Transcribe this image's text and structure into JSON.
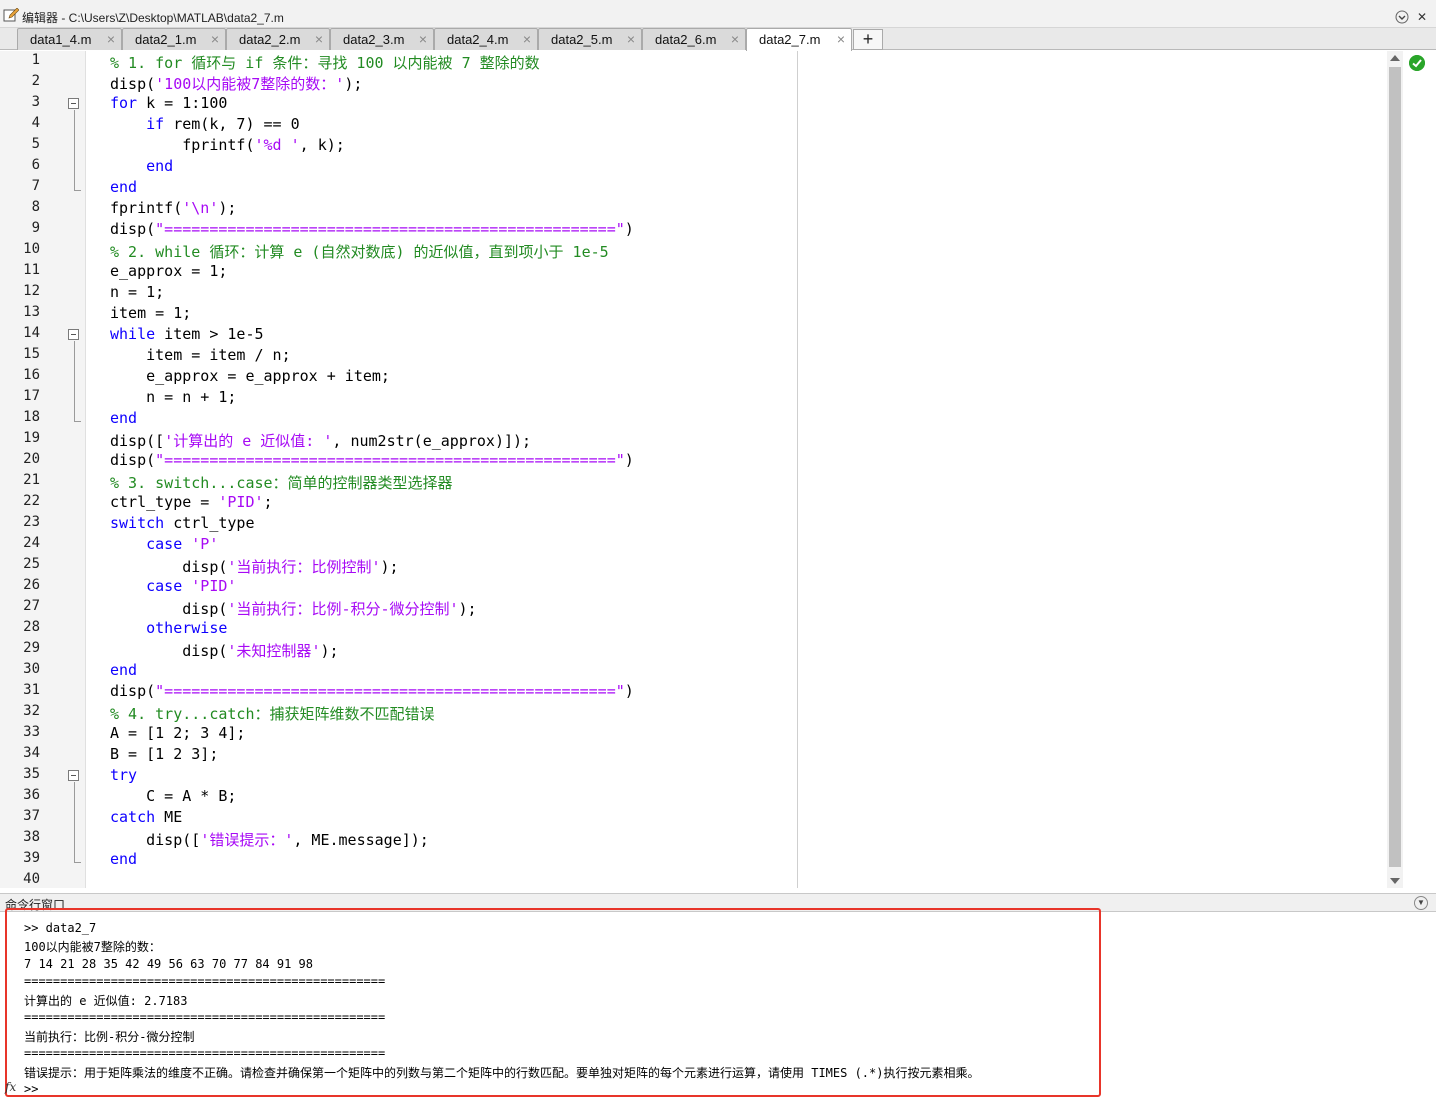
{
  "window": {
    "title": "编辑器 - C:\\Users\\Z\\Desktop\\MATLAB\\data2_7.m",
    "menu_icon": "chevron-down-icon",
    "close_icon": "close-icon"
  },
  "tabs": [
    {
      "label": "data1_4.m",
      "active": false
    },
    {
      "label": "data2_1.m",
      "active": false
    },
    {
      "label": "data2_2.m",
      "active": false
    },
    {
      "label": "data2_3.m",
      "active": false
    },
    {
      "label": "data2_4.m",
      "active": false
    },
    {
      "label": "data2_5.m",
      "active": false
    },
    {
      "label": "data2_6.m",
      "active": false
    },
    {
      "label": "data2_7.m",
      "active": true
    }
  ],
  "tab_close_glyph": "×",
  "tab_add_glyph": "+",
  "editor": {
    "line_numbers": [
      "1",
      "2",
      "3",
      "4",
      "5",
      "6",
      "7",
      "8",
      "9",
      "10",
      "11",
      "12",
      "13",
      "14",
      "15",
      "16",
      "17",
      "18",
      "19",
      "20",
      "21",
      "22",
      "23",
      "24",
      "25",
      "26",
      "27",
      "28",
      "29",
      "30",
      "31",
      "32",
      "33",
      "34",
      "35",
      "36",
      "37",
      "38",
      "39",
      "40"
    ],
    "lines": [
      [
        {
          "t": "% 1. for 循环与 if 条件：寻找 100 以内能被 7 整除的数",
          "c": "cmt"
        }
      ],
      [
        {
          "t": "disp(",
          "c": ""
        },
        {
          "t": "'100以内能被7整除的数：'",
          "c": "str"
        },
        {
          "t": ");",
          "c": ""
        }
      ],
      [
        {
          "t": "for",
          "c": "kw"
        },
        {
          "t": " k = 1:100",
          "c": ""
        }
      ],
      [
        {
          "t": "    ",
          "c": ""
        },
        {
          "t": "if",
          "c": "kw"
        },
        {
          "t": " rem(k, 7) == 0",
          "c": ""
        }
      ],
      [
        {
          "t": "        fprintf(",
          "c": ""
        },
        {
          "t": "'%d '",
          "c": "str"
        },
        {
          "t": ", k);",
          "c": ""
        }
      ],
      [
        {
          "t": "    ",
          "c": ""
        },
        {
          "t": "end",
          "c": "kw"
        }
      ],
      [
        {
          "t": "end",
          "c": "kw"
        }
      ],
      [
        {
          "t": "fprintf(",
          "c": ""
        },
        {
          "t": "'\\n'",
          "c": "str"
        },
        {
          "t": ");",
          "c": ""
        }
      ],
      [
        {
          "t": "disp(",
          "c": ""
        },
        {
          "t": "\"==================================================\"",
          "c": "str"
        },
        {
          "t": ")",
          "c": ""
        }
      ],
      [
        {
          "t": "% 2. while 循环：计算 e (自然对数底) 的近似值，直到项小于 1e-5",
          "c": "cmt"
        }
      ],
      [
        {
          "t": "e_approx = 1;",
          "c": ""
        }
      ],
      [
        {
          "t": "n = 1;",
          "c": ""
        }
      ],
      [
        {
          "t": "item = 1;",
          "c": ""
        }
      ],
      [
        {
          "t": "while",
          "c": "kw"
        },
        {
          "t": " item > 1e-5",
          "c": ""
        }
      ],
      [
        {
          "t": "    item = item / n;",
          "c": ""
        }
      ],
      [
        {
          "t": "    e_approx = e_approx + item;",
          "c": ""
        }
      ],
      [
        {
          "t": "    n = n + 1;",
          "c": ""
        }
      ],
      [
        {
          "t": "end",
          "c": "kw"
        }
      ],
      [
        {
          "t": "disp([",
          "c": ""
        },
        {
          "t": "'计算出的 e 近似值: '",
          "c": "str"
        },
        {
          "t": ", num2str(e_approx)]);",
          "c": ""
        }
      ],
      [
        {
          "t": "disp(",
          "c": ""
        },
        {
          "t": "\"==================================================\"",
          "c": "str"
        },
        {
          "t": ")",
          "c": ""
        }
      ],
      [
        {
          "t": "% 3. switch...case：简单的控制器类型选择器",
          "c": "cmt"
        }
      ],
      [
        {
          "t": "ctrl_type = ",
          "c": ""
        },
        {
          "t": "'PID'",
          "c": "str"
        },
        {
          "t": ";",
          "c": ""
        }
      ],
      [
        {
          "t": "switch",
          "c": "kw"
        },
        {
          "t": " ctrl_type",
          "c": ""
        }
      ],
      [
        {
          "t": "    ",
          "c": ""
        },
        {
          "t": "case",
          "c": "kw"
        },
        {
          "t": " ",
          "c": ""
        },
        {
          "t": "'P'",
          "c": "str"
        }
      ],
      [
        {
          "t": "        disp(",
          "c": ""
        },
        {
          "t": "'当前执行：比例控制'",
          "c": "str"
        },
        {
          "t": ");",
          "c": ""
        }
      ],
      [
        {
          "t": "    ",
          "c": ""
        },
        {
          "t": "case",
          "c": "kw"
        },
        {
          "t": " ",
          "c": ""
        },
        {
          "t": "'PID'",
          "c": "str"
        }
      ],
      [
        {
          "t": "        disp(",
          "c": ""
        },
        {
          "t": "'当前执行：比例-积分-微分控制'",
          "c": "str"
        },
        {
          "t": ");",
          "c": ""
        }
      ],
      [
        {
          "t": "    ",
          "c": ""
        },
        {
          "t": "otherwise",
          "c": "kw"
        }
      ],
      [
        {
          "t": "        disp(",
          "c": ""
        },
        {
          "t": "'未知控制器'",
          "c": "str"
        },
        {
          "t": ");",
          "c": ""
        }
      ],
      [
        {
          "t": "end",
          "c": "kw"
        }
      ],
      [
        {
          "t": "disp(",
          "c": ""
        },
        {
          "t": "\"==================================================\"",
          "c": "str"
        },
        {
          "t": ")",
          "c": ""
        }
      ],
      [
        {
          "t": "% 4. try...catch：捕获矩阵维数不匹配错误",
          "c": "cmt"
        }
      ],
      [
        {
          "t": "A = [1 2; 3 4];",
          "c": ""
        }
      ],
      [
        {
          "t": "B = [1 2 3];",
          "c": ""
        }
      ],
      [
        {
          "t": "try",
          "c": "kw"
        }
      ],
      [
        {
          "t": "    C = A * B;",
          "c": ""
        }
      ],
      [
        {
          "t": "catch",
          "c": "kw"
        },
        {
          "t": " ME",
          "c": ""
        }
      ],
      [
        {
          "t": "    disp([",
          "c": ""
        },
        {
          "t": "'错误提示：'",
          "c": "str"
        },
        {
          "t": ", ME.message]);",
          "c": ""
        }
      ],
      [
        {
          "t": "end",
          "c": "kw"
        }
      ],
      []
    ],
    "status_icon": "check-icon"
  },
  "command_window": {
    "title": "命令行窗口",
    "menu_icon": "chevron-down-icon",
    "output": [
      ">> data2_7",
      "100以内能被7整除的数：",
      "7 14 21 28 35 42 49 56 63 70 77 84 91 98",
      "==================================================",
      "计算出的 e 近似值: 2.7183",
      "==================================================",
      "当前执行：比例-积分-微分控制",
      "==================================================",
      "错误提示：用于矩阵乘法的维度不正确。请检查并确保第一个矩阵中的列数与第二个矩阵中的行数匹配。要单独对矩阵的每个元素进行运算，请使用 TIMES (.*)执行按元素相乘。"
    ],
    "fx_label": "fx",
    "prompt": ">>"
  }
}
